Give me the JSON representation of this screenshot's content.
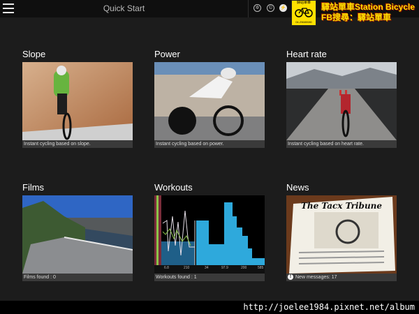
{
  "header": {
    "title": "Quick Start",
    "icons": [
      "menu-icon",
      "settings-icon",
      "copyright-icon",
      "power-icon"
    ]
  },
  "watermark": {
    "badge_text": "驛站單車",
    "badge_phone": "04-25680080",
    "line1": "驛站單車Station Bicycle",
    "line2": "FB搜尋：驛站單車",
    "color": "#ffe100"
  },
  "tiles": [
    {
      "title": "Slope",
      "caption": "Instant cycling based on slope."
    },
    {
      "title": "Power",
      "caption": "Instant cycling based on power."
    },
    {
      "title": "Heart rate",
      "caption": "Instant cycling based on heart rate."
    },
    {
      "title": "Films",
      "caption": "Films found : 0"
    },
    {
      "title": "Workouts",
      "caption": "Workouts found : 1",
      "ticks": [
        "6.8",
        "210",
        "34",
        "97.9",
        "200",
        "585"
      ]
    },
    {
      "title": "News",
      "caption": "New messages: 17",
      "newspaper_title": "The Tacx Tribune"
    }
  ],
  "footer": {
    "url": "http://joelee1984.pixnet.net/album"
  }
}
